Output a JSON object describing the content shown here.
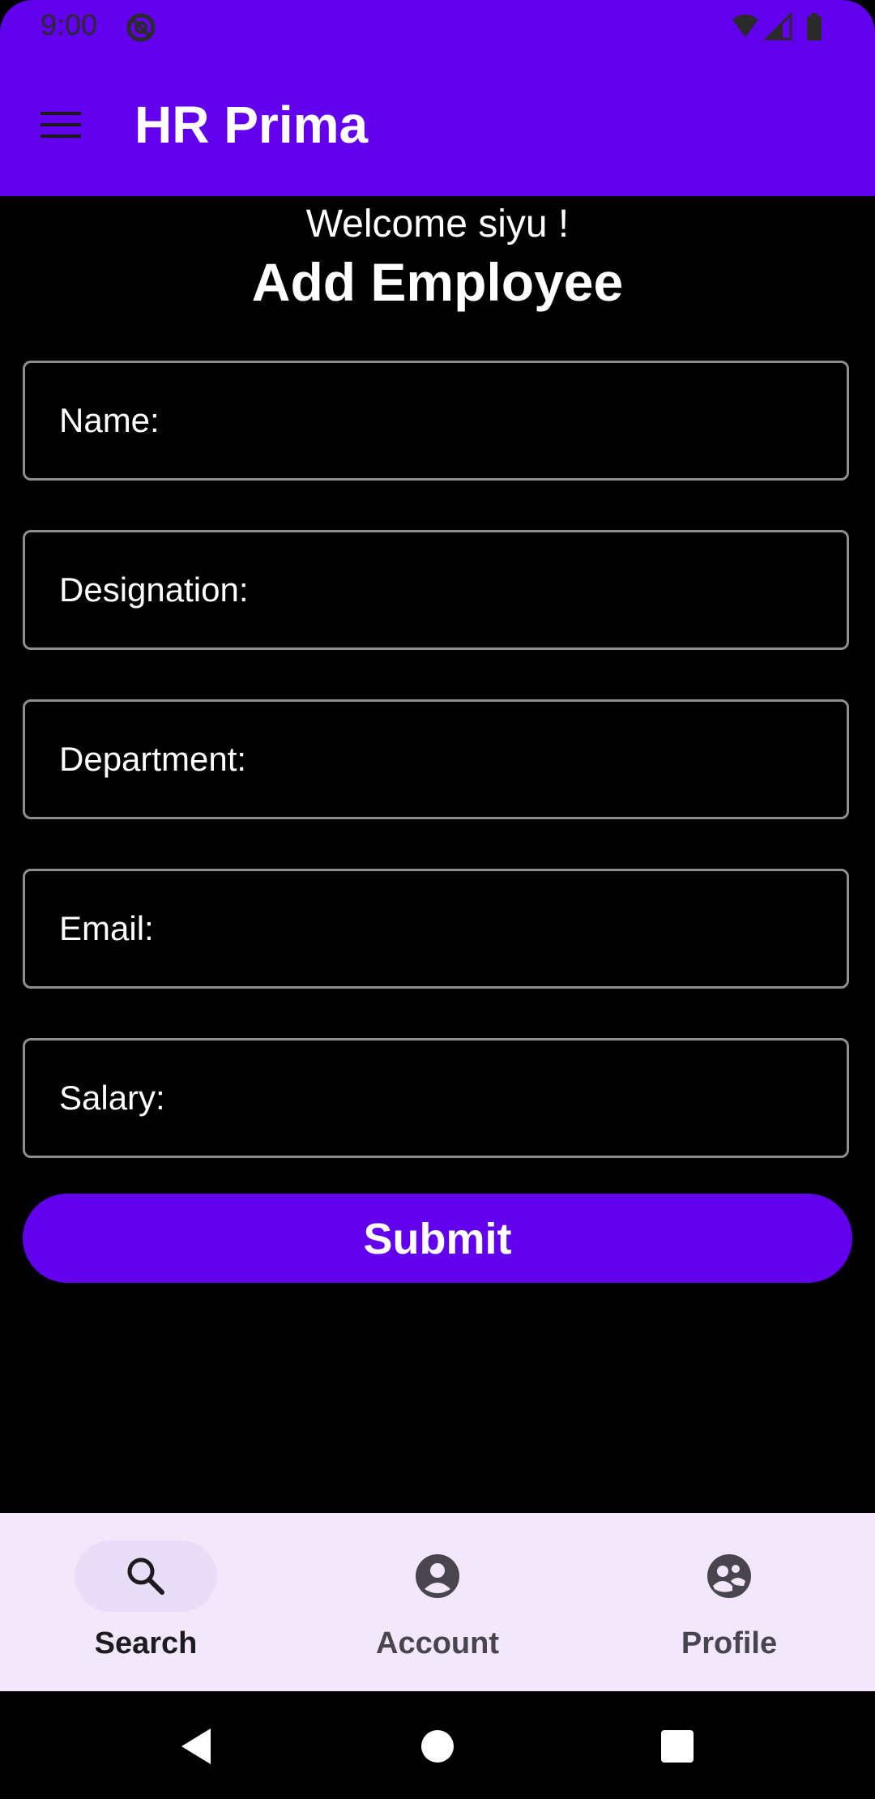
{
  "status_bar": {
    "time": "9:00"
  },
  "app_bar": {
    "title": "HR Prima",
    "menu_icon": "hamburger-menu-icon"
  },
  "header": {
    "welcome": "Welcome siyu !",
    "title": "Add Employee"
  },
  "form": {
    "fields": [
      {
        "label": "Name:",
        "value": ""
      },
      {
        "label": "Designation:",
        "value": ""
      },
      {
        "label": "Department:",
        "value": ""
      },
      {
        "label": "Email:",
        "value": ""
      },
      {
        "label": "Salary:",
        "value": ""
      }
    ],
    "submit_label": "Submit"
  },
  "bottom_nav": {
    "items": [
      {
        "label": "Search",
        "icon": "search-icon",
        "active": true
      },
      {
        "label": "Account",
        "icon": "account-circle-icon",
        "active": false
      },
      {
        "label": "Profile",
        "icon": "people-icon",
        "active": false
      }
    ]
  },
  "colors": {
    "primary": "#6200ee",
    "background": "#000000",
    "nav_background": "#f2e7fb",
    "field_border": "#8e8e8e"
  }
}
